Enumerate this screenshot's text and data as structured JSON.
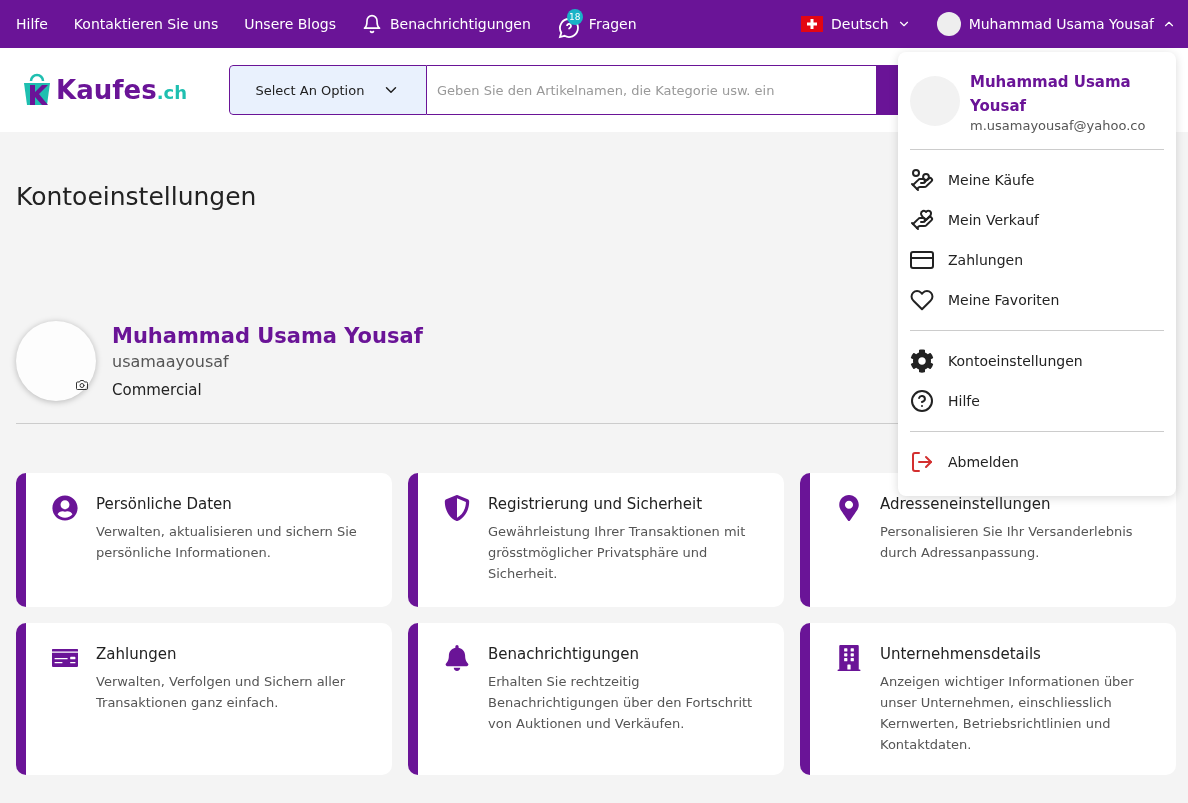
{
  "top_bar": {
    "links": [
      "Hilfe",
      "Kontaktieren Sie uns",
      "Unsere Blogs"
    ],
    "notifications": "Benachrichtigungen",
    "questions": {
      "label": "Fragen",
      "count": "18"
    },
    "language": "Deutsch",
    "user": "Muhammad Usama Yousaf",
    "menu_expanded": true
  },
  "header": {
    "logo": "Kaufes",
    "logo_suffix": ".ch",
    "category_select": "Select An Option",
    "search": {
      "placeholder": "Geben Sie den Artikelnamen, die Kategorie usw. ein"
    }
  },
  "page_title": "Kontoeinstellungen",
  "profile": {
    "name": "Muhammad Usama Yousaf",
    "username": "usamaayousaf",
    "account_type": "Commercial"
  },
  "cards": [
    {
      "title": "Persönliche Daten",
      "text": "Verwalten, aktualisieren und sichern Sie persönliche Informationen."
    },
    {
      "title": "Registrierung und Sicherheit",
      "text": "Gewährleistung Ihrer Transaktionen mit grösstmöglicher Privatsphäre und Sicherheit."
    },
    {
      "title": "Adresseneinstellungen",
      "text": "Personalisieren Sie Ihr Versanderlebnis durch Adressanpassung."
    },
    {
      "title": "Zahlungen",
      "text": "Verwalten, Verfolgen und Sichern aller Transaktionen ganz einfach."
    },
    {
      "title": "Benachrichtigungen",
      "text": "Erhalten Sie rechtzeitig Benachrichtigungen über den Fortschritt von Auktionen und Verkäufen."
    },
    {
      "title": "Unternehmensdetails",
      "text": "Anzeigen wichtiger Informationen über unser Unternehmen, einschliesslich Kernwerten, Betriebsrichtlinien und Kontaktdaten."
    }
  ],
  "user_menu": {
    "name": "Muhammad Usama Yousaf",
    "email": "m.usamayousaf@yahoo.co",
    "groups": [
      [
        "Meine Käufe",
        "Mein Verkauf",
        "Zahlungen",
        "Meine Favoriten"
      ],
      [
        "Kontoeinstellungen",
        "Hilfe"
      ],
      [
        "Abmelden"
      ]
    ]
  }
}
